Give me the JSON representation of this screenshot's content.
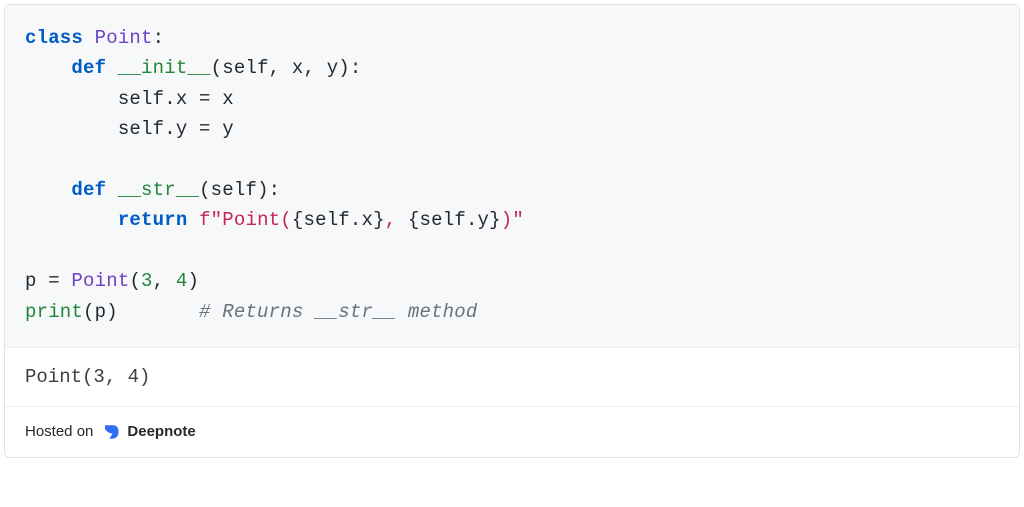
{
  "code": {
    "line1": {
      "kw_class": "class",
      "cls_name": "Point",
      "colon": ":"
    },
    "line2": {
      "indent": "    ",
      "kw_def": "def",
      "space1": " ",
      "fn_name": "__init__",
      "params": "(self, x, y):"
    },
    "line3": {
      "indent": "        ",
      "body": "self.x = x"
    },
    "line4": {
      "indent": "        ",
      "body": "self.y = y"
    },
    "line5": "",
    "line6": {
      "indent": "    ",
      "kw_def": "def",
      "space1": " ",
      "fn_name": "__str__",
      "params": "(self):"
    },
    "line7": {
      "indent": "        ",
      "kw_return": "return",
      "space1": " ",
      "str_prefix": "f\"Point(",
      "expr1": "{self.x}",
      "str_mid": ", ",
      "expr2": "{self.y}",
      "str_end": ")\""
    },
    "line8": "",
    "line9": {
      "lhs": "p = ",
      "cls": "Point",
      "open": "(",
      "n1": "3",
      "comma": ", ",
      "n2": "4",
      "close": ")"
    },
    "line10": {
      "fn": "print",
      "args": "(p)",
      "pad": "       ",
      "comment": "# Returns __str__ method"
    }
  },
  "output": "Point(3, 4)",
  "footer": {
    "hosted_on": "Hosted on",
    "brand": "Deepnote"
  }
}
